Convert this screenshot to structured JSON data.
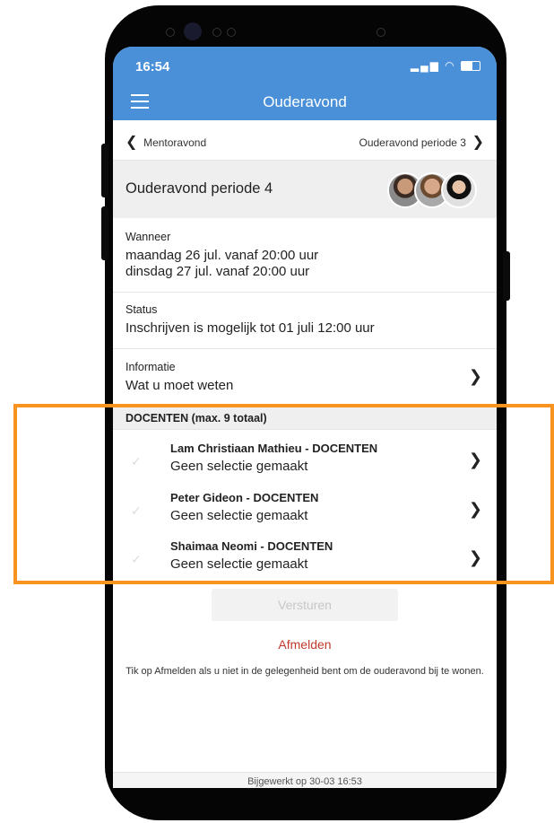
{
  "status_bar": {
    "time": "16:54",
    "icons": "signal wifi battery"
  },
  "nav": {
    "title": "Ouderavond",
    "menu_icon": "hamburger-icon"
  },
  "period_nav": {
    "prev_label": "Mentoravond",
    "next_label": "Ouderavond periode 3"
  },
  "header": {
    "title": "Ouderavond periode 4"
  },
  "wanneer": {
    "label": "Wanneer",
    "lines": [
      "maandag 26 jul. vanaf 20:00 uur",
      "dinsdag 27 jul. vanaf 20:00 uur"
    ]
  },
  "status": {
    "label": "Status",
    "value": "Inschrijven is mogelijk tot 01 juli 12:00 uur"
  },
  "informatie": {
    "label": "Informatie",
    "value": "Wat u moet weten"
  },
  "docenten": {
    "header": "DOCENTEN (max. 9 totaal)",
    "items": [
      {
        "name": "Lam Christiaan Mathieu - DOCENTEN",
        "selection": "Geen selectie gemaakt"
      },
      {
        "name": "Peter Gideon  - DOCENTEN",
        "selection": "Geen selectie gemaakt"
      },
      {
        "name": "Shaimaa Neomi  - DOCENTEN",
        "selection": "Geen selectie gemaakt"
      }
    ]
  },
  "actions": {
    "submit": "Versturen",
    "unsubscribe": "Afmelden"
  },
  "note": "Tik op Afmelden als u niet in de gelegenheid bent om de ouderavond bij te wonen.",
  "footer": "Bijgewerkt op 30-03 16:53",
  "colors": {
    "header_blue": "#4a90d9",
    "highlight": "#f7931e",
    "unsubscribe_red": "#c0392b"
  }
}
